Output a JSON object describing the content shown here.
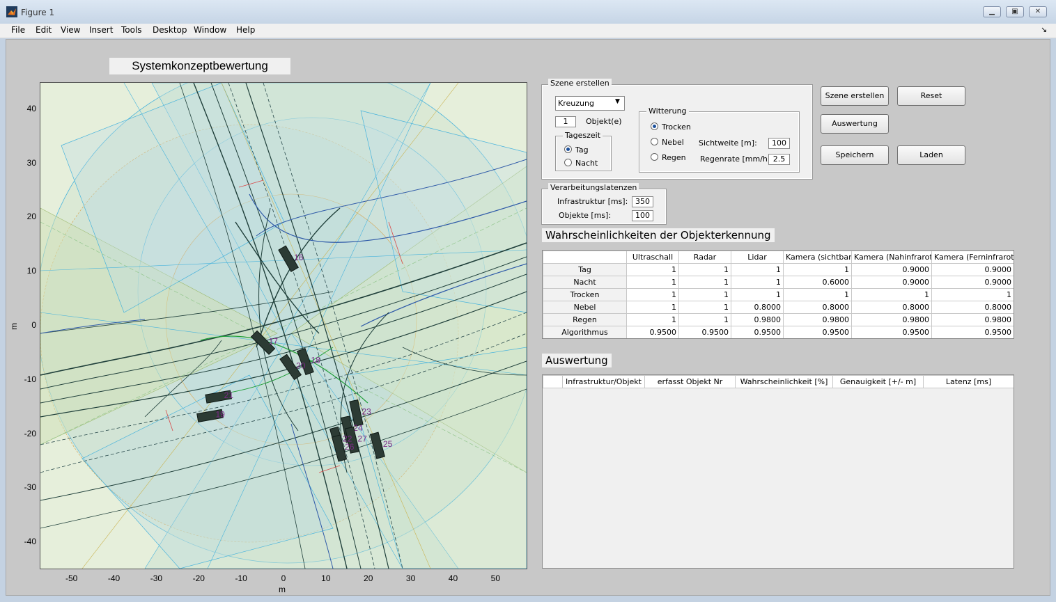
{
  "window": {
    "title": "Figure 1"
  },
  "menu": [
    "File",
    "Edit",
    "View",
    "Insert",
    "Tools",
    "Desktop",
    "Window",
    "Help"
  ],
  "plot": {
    "title": "Systemkonzeptbewertung",
    "xlabel": "m",
    "ylabel": "m",
    "xticks": [
      "-50",
      "-40",
      "-30",
      "-20",
      "-10",
      "0",
      "10",
      "20",
      "30",
      "40",
      "50"
    ],
    "yticks": [
      "40",
      "30",
      "20",
      "10",
      "0",
      "-10",
      "-20",
      "-30",
      "-40"
    ],
    "xlim": [
      -57.5,
      57.5
    ],
    "ylim": [
      -45,
      45
    ],
    "objects": [
      {
        "id": "16",
        "x": 1,
        "y": 12.5,
        "angle": 60
      },
      {
        "id": "17",
        "x": -5,
        "y": -3,
        "angle": 45
      },
      {
        "id": "18",
        "x": 5,
        "y": -6.5,
        "angle": 70
      },
      {
        "id": "20",
        "x": 1.5,
        "y": -7.5,
        "angle": 55
      },
      {
        "id": "21",
        "x": -15.5,
        "y": -13,
        "angle": -10
      },
      {
        "id": "19",
        "x": -17.5,
        "y": -16.5,
        "angle": -10
      },
      {
        "id": "23",
        "x": 17,
        "y": -16,
        "angle": 78
      },
      {
        "id": "24",
        "x": 15,
        "y": -19,
        "angle": 78
      },
      {
        "id": "27",
        "x": 16,
        "y": -21,
        "angle": 78
      },
      {
        "id": "22",
        "x": 12.5,
        "y": -21,
        "angle": 75
      },
      {
        "id": "26",
        "x": 13,
        "y": -22.5,
        "angle": 75
      },
      {
        "id": "25",
        "x": 22,
        "y": -22,
        "angle": 75
      }
    ]
  },
  "szene": {
    "title": "Szene erstellen",
    "scene_select": "Kreuzung",
    "object_count": "1",
    "object_label": "Objekt(e)",
    "tageszeit": {
      "title": "Tageszeit",
      "tag": "Tag",
      "nacht": "Nacht",
      "selected": "Tag"
    },
    "witterung": {
      "title": "Witterung",
      "trocken": "Trocken",
      "nebel": "Nebel",
      "regen": "Regen",
      "selected": "Trocken",
      "sichtweite_label": "Sichtweite [m]:",
      "sichtweite_value": "100",
      "regenrate_label": "Regenrate [mm/h]:",
      "regenrate_value": "2.5"
    }
  },
  "buttons": {
    "szene_erstellen": "Szene erstellen",
    "reset": "Reset",
    "auswertung": "Auswertung",
    "speichern": "Speichern",
    "laden": "Laden"
  },
  "latenzen": {
    "title": "Verarbeitungslatenzen",
    "infra_label": "Infrastruktur [ms]:",
    "infra_value": "350",
    "objekte_label": "Objekte [ms]:",
    "objekte_value": "100"
  },
  "probability_table": {
    "title": "Wahrscheinlichkeiten der Objekterkennung",
    "columns": [
      "Ultraschall",
      "Radar",
      "Lidar",
      "Kamera (sichtbar)",
      "Kamera (Nahinfrarot)",
      "Kamera (Ferninfrarot)"
    ],
    "rows": [
      {
        "label": "Tag",
        "values": [
          "1",
          "1",
          "1",
          "1",
          "0.9000",
          "0.9000"
        ]
      },
      {
        "label": "Nacht",
        "values": [
          "1",
          "1",
          "1",
          "0.6000",
          "0.9000",
          "0.9000"
        ]
      },
      {
        "label": "Trocken",
        "values": [
          "1",
          "1",
          "1",
          "1",
          "1",
          "1"
        ]
      },
      {
        "label": "Nebel",
        "values": [
          "1",
          "1",
          "0.8000",
          "0.8000",
          "0.8000",
          "0.8000"
        ]
      },
      {
        "label": "Regen",
        "values": [
          "1",
          "1",
          "0.9800",
          "0.9800",
          "0.9800",
          "0.9800"
        ]
      },
      {
        "label": "Algorithmus",
        "values": [
          "0.9500",
          "0.9500",
          "0.9500",
          "0.9500",
          "0.9500",
          "0.9500"
        ]
      }
    ]
  },
  "auswertung_table": {
    "title": "Auswertung",
    "columns": [
      "",
      "Infrastruktur/Objekt",
      "erfasst Objekt Nr",
      "Wahrscheinlichkeit [%]",
      "Genauigkeit [+/- m]",
      "Latenz [ms]"
    ]
  },
  "colors": {
    "object_label": "#7b2a86",
    "vehicle": "#2c3b34",
    "sensor_blue": "#3fb0dc",
    "sensor_green": "#8fc48a",
    "sensor_orange": "#d99a3a"
  }
}
